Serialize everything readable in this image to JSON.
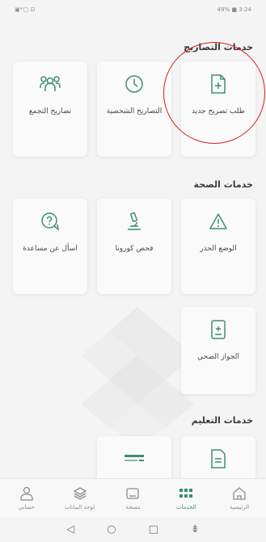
{
  "status_bar": {
    "left": "▣⁴ᴵ▢ ⊡",
    "right": "49% ■ 3:24"
  },
  "sections": {
    "permits": {
      "title": "خدمات التصاريح"
    },
    "health": {
      "title": "خدمات الصحة"
    },
    "education": {
      "title": "خدمات التعليم"
    }
  },
  "cards": {
    "permit_request": "طلب تصريح جديد",
    "personal_permits": "التصاريح الشخصية",
    "gathering_permits": "تصاريح التجمع",
    "health_status": "الوضع الحذر",
    "corona_test": "فحص كورونا",
    "ask_help": "اسأل عن مساعدة",
    "health_passport": "الجواز الصحي"
  },
  "nav": {
    "home": "الرئيسية",
    "services": "الخدمات",
    "checkup": "مسحة",
    "dashboard": "لوحة البيانات",
    "account": "حسابي"
  },
  "colors": {
    "accent": "#3f8c79",
    "icon": "#3f8c79",
    "highlight": "#d42020"
  }
}
